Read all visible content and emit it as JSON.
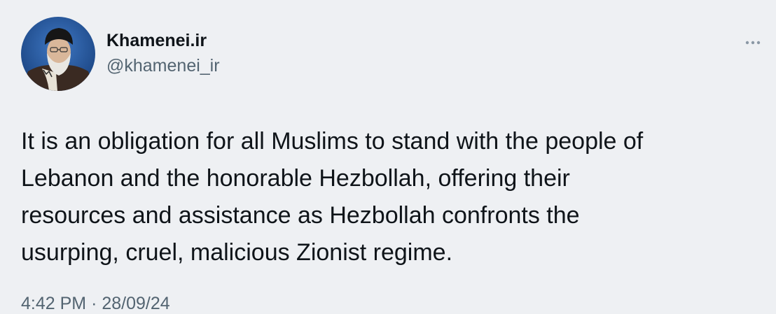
{
  "tweet": {
    "author": {
      "display_name": "Khamenei.ir",
      "handle": "@khamenei_ir",
      "avatar_icon": "profile-photo"
    },
    "more_icon": "ellipsis-icon",
    "text": "It is an obligation for all Muslims to stand with the people of\nLebanon and the honorable Hezbollah, offering their\nresources and assistance as Hezbollah confronts the\nusurping, cruel, malicious Zionist regime.",
    "time": "4:42 PM",
    "separator": "·",
    "date": "28/09/24"
  },
  "colors": {
    "background": "#eef0f3",
    "text_primary": "#0f1419",
    "text_secondary": "#536471"
  }
}
